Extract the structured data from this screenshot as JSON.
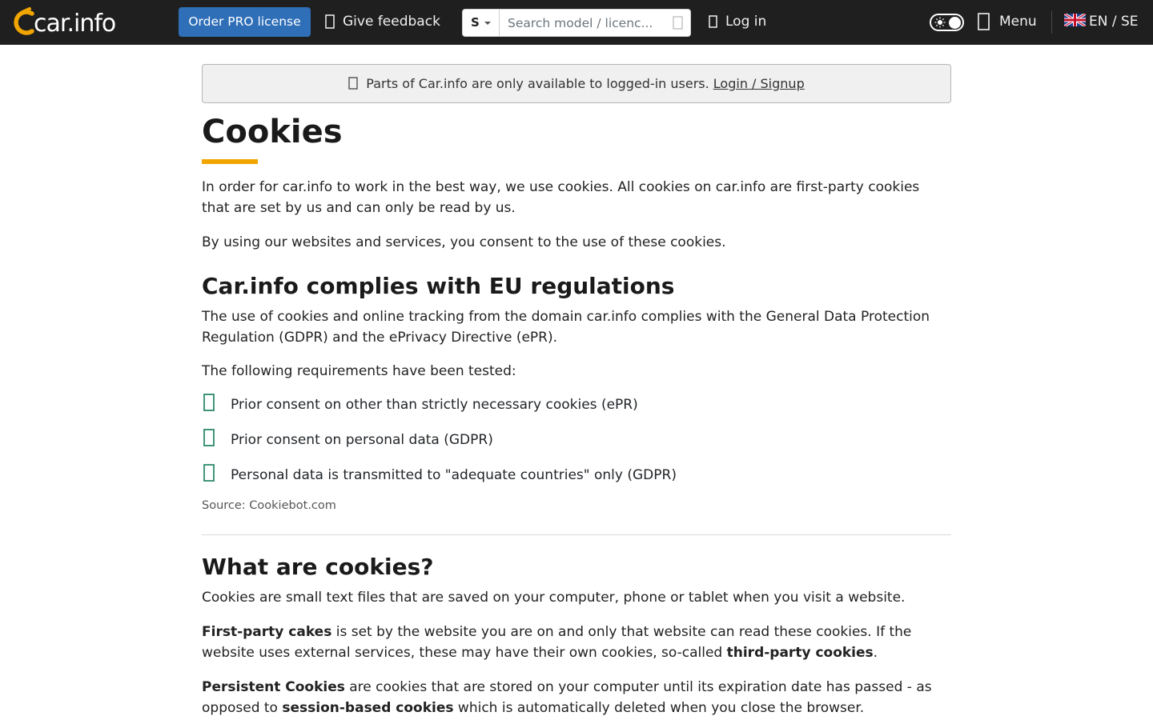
{
  "header": {
    "logo": "car.info",
    "pro_button": "Order PRO license",
    "feedback": "Give feedback",
    "search": {
      "type": "S",
      "placeholder": "Search model / licenc..."
    },
    "login": "Log in",
    "menu": "Menu",
    "language": "EN / SE"
  },
  "notice": {
    "text": "Parts of Car.info are only available to logged-in users.",
    "link": "Login / Signup"
  },
  "page": {
    "title": "Cookies",
    "accent_color": "#f0a500",
    "intro": [
      "In order for car.info to work in the best way, we use cookies. All cookies on car.info are first-party cookies that are set by us and can only be read by us.",
      "By using our websites and services, you consent to the use of these cookies."
    ],
    "eu": {
      "heading": "Car.info complies with EU regulations",
      "text": "The use of cookies and online tracking from the domain car.info complies with the General Data Protection Regulation (GDPR) and the ePrivacy Directive (ePR).",
      "requirements_intro": "The following requirements have been tested:",
      "requirements": [
        "Prior consent on other than strictly necessary cookies (ePR)",
        "Prior consent on personal data (GDPR)",
        "Personal data is transmitted to \"adequate countries\" only (GDPR)"
      ],
      "check_color": "#2e8b6a",
      "source": "Source: Cookiebot.com"
    },
    "what": {
      "heading": "What are cookies?",
      "text": "Cookies are small text files that are saved on your computer, phone or tablet when you visit a website.",
      "first_party": {
        "bold": "First-party cakes",
        "text1": " is set by the website you are on and only that website can read these cookies. If the website uses external services, these may have their own cookies, so-called ",
        "bold2": "third-party cookies",
        "text2": "."
      },
      "persistent": {
        "bold": "Persistent Cookies",
        "text1": " are cookies that are stored on your computer until its expiration date has passed - as opposed to ",
        "bold2": "session-based cookies",
        "text2": " which is automatically deleted when you close the browser."
      }
    }
  }
}
